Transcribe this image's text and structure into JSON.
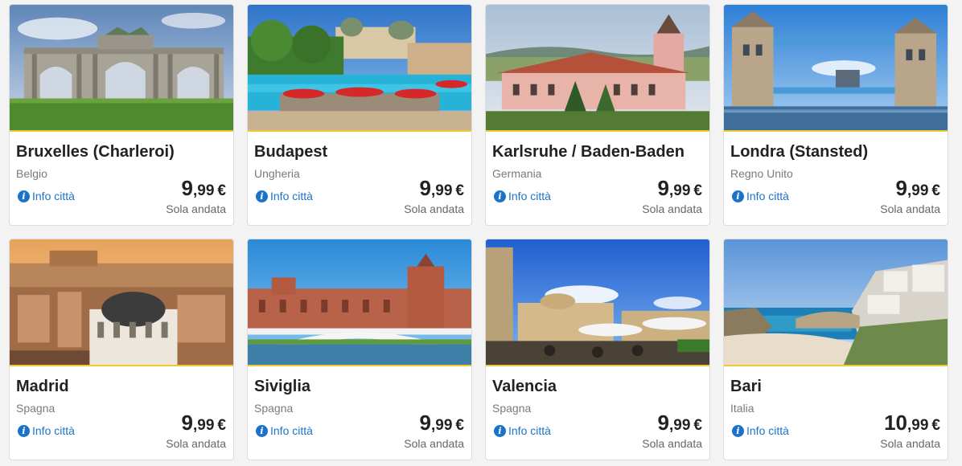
{
  "destinations": [
    {
      "city": "Bruxelles (Charleroi)",
      "country": "Belgio",
      "info_label": "Info città",
      "price_int": "9",
      "price_dec": ",99",
      "currency": "€",
      "trip_type": "Sola andata"
    },
    {
      "city": "Budapest",
      "country": "Ungheria",
      "info_label": "Info città",
      "price_int": "9",
      "price_dec": ",99",
      "currency": "€",
      "trip_type": "Sola andata"
    },
    {
      "city": "Karlsruhe / Baden-Baden",
      "country": "Germania",
      "info_label": "Info città",
      "price_int": "9",
      "price_dec": ",99",
      "currency": "€",
      "trip_type": "Sola andata"
    },
    {
      "city": "Londra (Stansted)",
      "country": "Regno Unito",
      "info_label": "Info città",
      "price_int": "9",
      "price_dec": ",99",
      "currency": "€",
      "trip_type": "Sola andata"
    },
    {
      "city": "Madrid",
      "country": "Spagna",
      "info_label": "Info città",
      "price_int": "9",
      "price_dec": ",99",
      "currency": "€",
      "trip_type": "Sola andata"
    },
    {
      "city": "Siviglia",
      "country": "Spagna",
      "info_label": "Info città",
      "price_int": "9",
      "price_dec": ",99",
      "currency": "€",
      "trip_type": "Sola andata"
    },
    {
      "city": "Valencia",
      "country": "Spagna",
      "info_label": "Info città",
      "price_int": "9",
      "price_dec": ",99",
      "currency": "€",
      "trip_type": "Sola andata"
    },
    {
      "city": "Bari",
      "country": "Italia",
      "info_label": "Info città",
      "price_int": "10",
      "price_dec": ",99",
      "currency": "€",
      "trip_type": "Sola andata"
    }
  ],
  "colors": {
    "accent_line": "#f1c933",
    "link": "#1a73c8",
    "text": "#222222",
    "muted": "#7a7a7a"
  },
  "icons": {
    "info": "info-circle-icon"
  }
}
